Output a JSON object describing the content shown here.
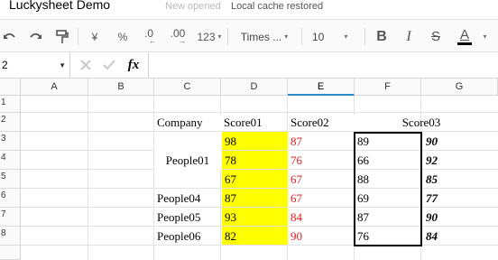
{
  "app": {
    "title": "Luckysheet Demo",
    "status_dim": "New opened",
    "status": "Local cache restored"
  },
  "toolbar": {
    "undo_icon": "undo-icon",
    "redo_icon": "redo-icon",
    "paint_format_icon": "paint-format-icon",
    "currency": "¥",
    "percent": "%",
    "decrease_decimal": ".0",
    "increase_decimal": ".00",
    "number_format": "123",
    "font_family": "Times ...",
    "font_size": "10",
    "bold": "B",
    "italic": "I",
    "strikethrough": "S",
    "text_color": "A"
  },
  "formula_bar": {
    "cell_ref": "2",
    "fx": "fx"
  },
  "grid": {
    "columns": [
      "A",
      "B",
      "C",
      "D",
      "E",
      "F",
      "G"
    ],
    "rows": [
      "1",
      "2",
      "3",
      "4",
      "5",
      "6",
      "7",
      "8"
    ],
    "headers": {
      "company": "Company",
      "score01": "Score01",
      "score02": "Score02",
      "score03": "Score03"
    },
    "data": {
      "people01": "People01",
      "people04": "People04",
      "people05": "People05",
      "people06": "People06",
      "d": [
        "98",
        "78",
        "67",
        "87",
        "93",
        "82"
      ],
      "e": [
        "87",
        "76",
        "67",
        "67",
        "84",
        "90"
      ],
      "f": [
        "89",
        "66",
        "88",
        "69",
        "87",
        "76"
      ],
      "g": [
        "90",
        "92",
        "85",
        "77",
        "90",
        "84"
      ]
    }
  },
  "colors": {
    "highlight": "#ffff00",
    "red_text": "#e02020",
    "active_column": "#2c89c6"
  }
}
